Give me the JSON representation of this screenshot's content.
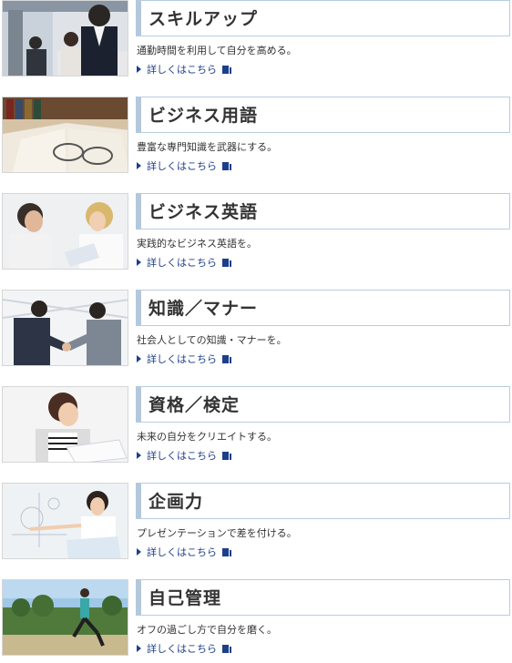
{
  "items": [
    {
      "title": "スキルアップ",
      "desc": "通勤時間を利用して自分を高める。",
      "more": "詳しくはこちら",
      "thumb_icon": "commuters-reading-photo"
    },
    {
      "title": "ビジネス用語",
      "desc": "豊富な専門知識を武器にする。",
      "more": "詳しくはこちら",
      "thumb_icon": "open-book-glasses-photo"
    },
    {
      "title": "ビジネス英語",
      "desc": "実践的なビジネス英語を。",
      "more": "詳しくはこちら",
      "thumb_icon": "business-conversation-photo"
    },
    {
      "title": "知識／マナー",
      "desc": "社会人としての知識・マナーを。",
      "more": "詳しくはこちら",
      "thumb_icon": "handshake-photo"
    },
    {
      "title": "資格／検定",
      "desc": "未来の自分をクリエイトする。",
      "more": "詳しくはこちら",
      "thumb_icon": "woman-studying-photo"
    },
    {
      "title": "企画力",
      "desc": "プレゼンテーションで差を付ける。",
      "more": "詳しくはこちら",
      "thumb_icon": "presentation-photo"
    },
    {
      "title": "自己管理",
      "desc": "オフの過ごし方で自分を磨く。",
      "more": "詳しくはこちら",
      "thumb_icon": "runner-outdoors-photo"
    }
  ],
  "colors": {
    "link": "#1d3f8a",
    "title_border": "#b4c8dc",
    "text": "#333333"
  }
}
